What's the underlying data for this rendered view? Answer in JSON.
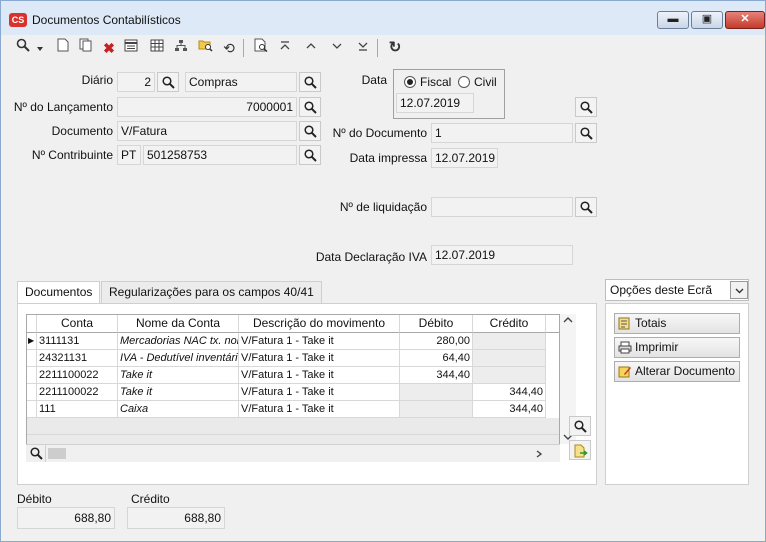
{
  "window": {
    "title": "Documentos Contabilísticos",
    "icon_text": "CS",
    "btn_min": "▬",
    "btn_max": "▣",
    "btn_close": "✕"
  },
  "toolbar": {
    "icons": [
      "search-icon",
      "dropdown-icon",
      "new-document-icon",
      "copy-icon",
      "delete-icon",
      "form-view-icon",
      "grid-view-icon",
      "hierarchy-icon",
      "folder-search-icon",
      "refresh-icon",
      "print-preview-icon",
      "first-icon",
      "previous-icon",
      "next-icon",
      "last-icon",
      "reload-icon"
    ]
  },
  "form": {
    "diario_label": "Diário",
    "diario_code": "2",
    "diario_name": "Compras",
    "lancamento_label": "Nº do Lançamento",
    "lancamento_value": "7000001",
    "documento_label": "Documento",
    "documento_value": "V/Fatura",
    "contribuinte_label": "Nº Contribuinte",
    "contribuinte_country": "PT",
    "contribuinte_value": "501258753",
    "data_label": "Data",
    "fiscal_label": "Fiscal",
    "civil_label": "Civil",
    "data_value": "12.07.2019",
    "ndoc_label": "Nº do Documento",
    "ndoc_value": "1",
    "data_impressa_label": "Data impressa",
    "data_impressa_value": "12.07.2019",
    "liquidacao_label": "Nº de liquidação",
    "liquidacao_value": "",
    "data_iva_label": "Data Declaração IVA",
    "data_iva_value": "12.07.2019"
  },
  "tabs": [
    "Documentos",
    "Regularizações para os campos 40/41"
  ],
  "grid": {
    "headers": [
      "Conta",
      "Nome da Conta",
      "Descrição do movimento",
      "Débito",
      "Crédito"
    ],
    "rows": [
      {
        "conta": "3111131",
        "nome": "Mercadorias NAC tx. normal",
        "desc": "V/Fatura  1 - Take it",
        "debito": "280,00",
        "credito": ""
      },
      {
        "conta": "24321131",
        "nome": "IVA - Dedutível inventário",
        "desc": "V/Fatura  1 - Take it",
        "debito": "64,40",
        "credito": ""
      },
      {
        "conta": "2211100022",
        "nome": "Take it",
        "desc": "V/Fatura  1 - Take it",
        "debito": "344,40",
        "credito": ""
      },
      {
        "conta": "2211100022",
        "nome": "Take it",
        "desc": "V/Fatura  1 - Take it",
        "debito": "",
        "credito": "344,40"
      },
      {
        "conta": "111",
        "nome": "Caixa",
        "desc": "V/Fatura  1 - Take it",
        "debito": "",
        "credito": "344,40"
      }
    ]
  },
  "options": {
    "title": "Opções deste Ecrã",
    "buttons": [
      "Totais",
      "Imprimir",
      "Alterar Documento"
    ]
  },
  "totals": {
    "debito_label": "Débito",
    "debito_value": "688,80",
    "credito_label": "Crédito",
    "credito_value": "688,80"
  }
}
